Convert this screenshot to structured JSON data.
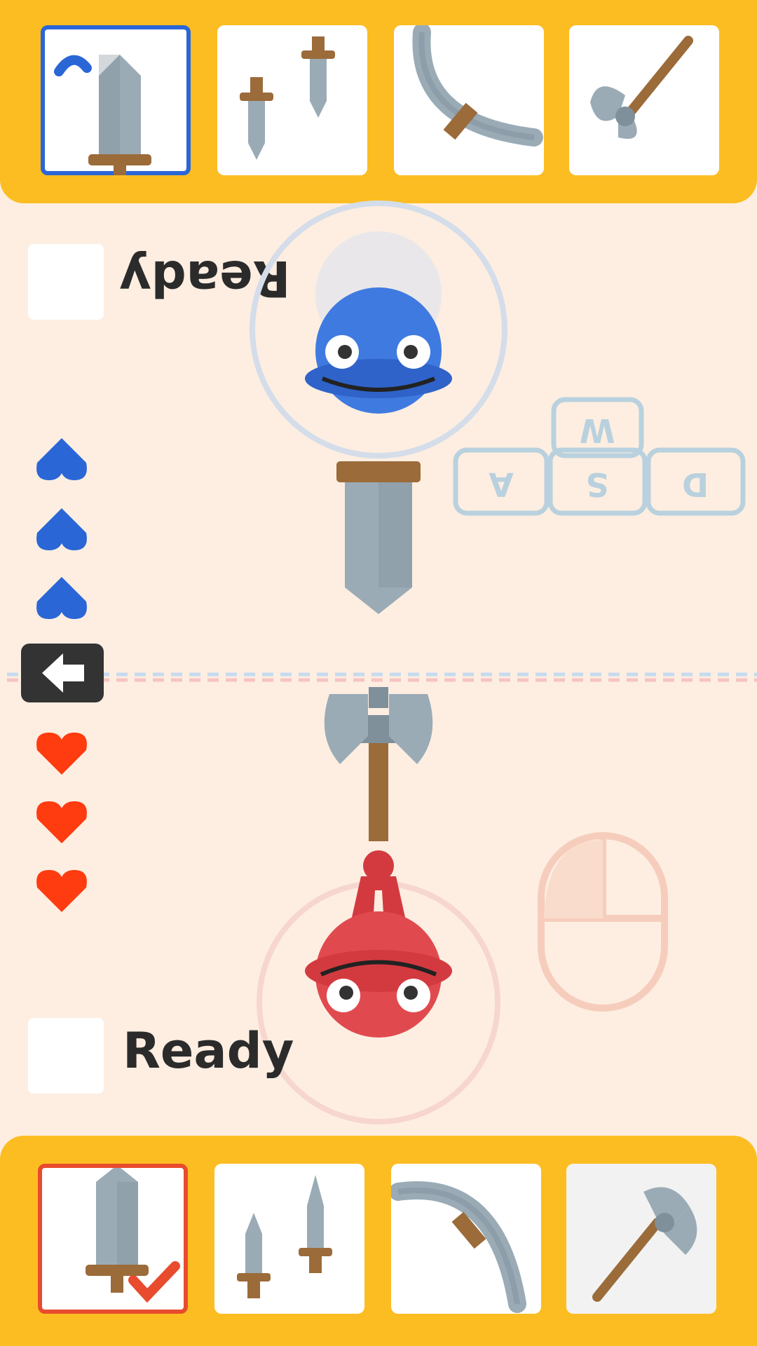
{
  "players": {
    "blue": {
      "ready_label": "Ready",
      "lives": 3,
      "color": "#2a66d6",
      "controls": {
        "keys": [
          "W",
          "A",
          "S",
          "D"
        ]
      }
    },
    "red": {
      "ready_label": "Ready",
      "lives": 3,
      "color": "#ff3b10",
      "controls": {
        "input": "mouse"
      }
    }
  },
  "weapons": [
    "sword",
    "daggers",
    "saw-blade",
    "axe"
  ],
  "colors": {
    "bar": "#fcbd22",
    "background": "#fdeee1",
    "blue_player": "#3f7ae0",
    "red_player": "#e04a4f",
    "metal": "#9aabb6",
    "wood": "#9b6b3a"
  },
  "icons": {
    "back": "back-arrow-icon",
    "heart": "heart-icon"
  }
}
